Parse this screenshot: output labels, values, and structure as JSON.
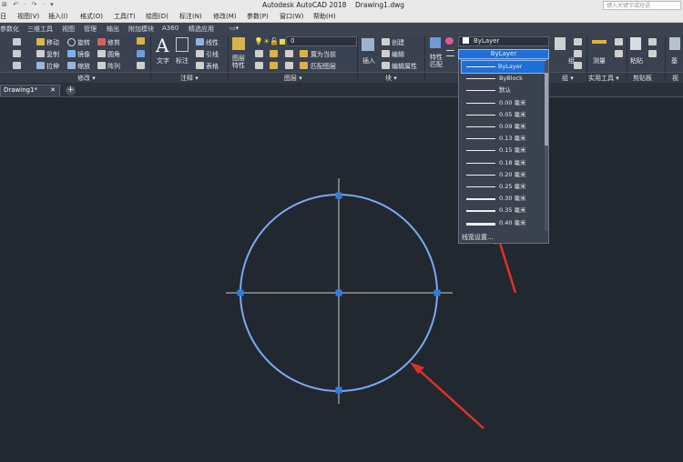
{
  "app": {
    "title": "Autodesk AutoCAD 2018    Drawing1.dwg",
    "search_placeholder": "键入关键字或短语",
    "quick_access": "⊞ ↶ · ↷ · ▾"
  },
  "menubar": [
    "日",
    "视图(V)",
    "插入(I)",
    "格式(O)",
    "工具(T)",
    "绘图(D)",
    "标注(N)",
    "修改(M)",
    "参数(P)",
    "窗口(W)",
    "帮助(H)"
  ],
  "ribbon_tabs": [
    "参数化",
    "三维工具",
    "视图",
    "管理",
    "输出",
    "附加模块",
    "A360",
    "精选应用",
    "▭▾"
  ],
  "ribbon": {
    "modify": {
      "move": "移动",
      "rotate": "旋转",
      "trim": "修剪",
      "copy": "复制",
      "mirror": "镜像",
      "fillet": "圆角",
      "stretch": "拉伸",
      "scale": "缩放",
      "array": "阵列"
    },
    "annotation": {
      "text": "文字",
      "dimension": "标注",
      "linear": "线性",
      "leader": "引线",
      "table": "表格"
    },
    "layers": {
      "layer_props": "图层\n特性",
      "layer_value": "0",
      "set_current": "置为当前",
      "match_layer": "匹配图层"
    },
    "block": {
      "insert": "插入",
      "create": "创建",
      "edit": "编辑",
      "edit_attr": "编辑属性"
    },
    "properties": {
      "match": "特性\n匹配",
      "color_value": "ByLayer",
      "lineweight_value": "ByLayer"
    },
    "groups": {
      "group": "组"
    },
    "utilities": {
      "measure": "测量"
    },
    "clipboard": {
      "paste": "粘贴"
    },
    "base": {
      "label": "基"
    }
  },
  "panel_titles": [
    "修改 ▾",
    "注释 ▾",
    "图层 ▾",
    "块 ▾",
    "组 ▾",
    "实用工具 ▾",
    "剪贴板",
    "视"
  ],
  "file_tab": {
    "name": "Drawing1*",
    "close": "✕",
    "add": "+"
  },
  "lineweight_dropdown": {
    "items": [
      {
        "label": "ByLayer",
        "weight": 1,
        "selected": true
      },
      {
        "label": "ByBlock",
        "weight": 1
      },
      {
        "label": "默认",
        "weight": 1
      },
      {
        "label": "0.00 毫米",
        "weight": 1
      },
      {
        "label": "0.05 毫米",
        "weight": 1
      },
      {
        "label": "0.09 毫米",
        "weight": 1
      },
      {
        "label": "0.13 毫米",
        "weight": 1
      },
      {
        "label": "0.15 毫米",
        "weight": 1
      },
      {
        "label": "0.18 毫米",
        "weight": 1
      },
      {
        "label": "0.20 毫米",
        "weight": 1
      },
      {
        "label": "0.25 毫米",
        "weight": 1
      },
      {
        "label": "0.30 毫米",
        "weight": 2
      },
      {
        "label": "0.35 毫米",
        "weight": 2
      },
      {
        "label": "0.40 毫米",
        "weight": 3
      }
    ],
    "settings_label": "线宽设置..."
  },
  "colors": {
    "accent_blue": "#1f6fd6",
    "circle": "#7ea8f0",
    "arrow": "#e0302a",
    "canvas": "#212830"
  }
}
